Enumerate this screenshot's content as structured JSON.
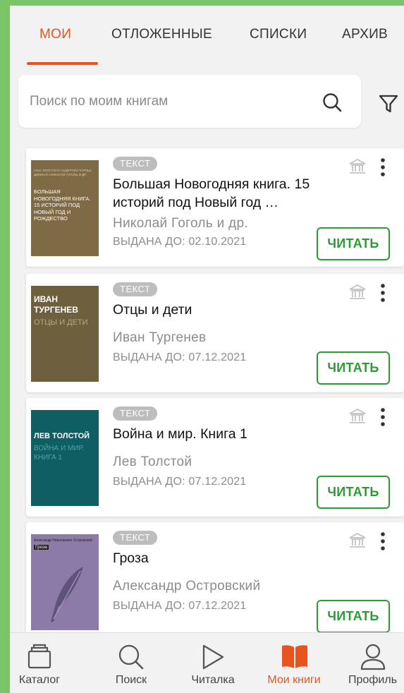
{
  "tabs": [
    {
      "label": "МОИ",
      "active": true
    },
    {
      "label": "ОТЛОЖЕННЫЕ",
      "active": false
    },
    {
      "label": "СПИСКИ",
      "active": false
    },
    {
      "label": "АРХИВ",
      "active": false
    }
  ],
  "search": {
    "placeholder": "Поиск по моим книгам",
    "value": ""
  },
  "colors": {
    "accent": "#e8531f",
    "read_button": "#2e9a35",
    "badge": "#bdbdbd"
  },
  "books": [
    {
      "badge": "ТЕКСТ",
      "title": "Большая Новогодняя книга. 15 историй под Новый год …",
      "author": "Николай Гоголь и др.",
      "due": "ВЫДАНА ДО: 02.10.2021",
      "read_label": "ЧИТАТЬ",
      "cover": {
        "color": "#7e6a45",
        "authors_text": "ГАНС КРИСТИАН АНДЕРСЕН ЧАРЛЬЗ ДИККЕНС НИКОЛАЙ ГОГОЛЬ И ДР.",
        "title_text": "БОЛЬШАЯ НОВОГОДНЯЯ КНИГА. 15 ИСТОРИЙ ПОД НОВЫЙ ГОД И РОЖДЕСТВО"
      }
    },
    {
      "badge": "ТЕКСТ",
      "title": "Отцы и дети",
      "author": "Иван Тургенев",
      "due": "ВЫДАНА ДО: 07.12.2021",
      "read_label": "ЧИТАТЬ",
      "cover": {
        "color": "#6e5f3e",
        "author_text": "ИВАН ТУРГЕНЕВ",
        "title_text": "ОТЦЫ И ДЕТИ"
      }
    },
    {
      "badge": "ТЕКСТ",
      "title": "Война и мир. Книга 1",
      "author": "Лев Толстой",
      "due": "ВЫДАНА ДО: 07.12.2021",
      "read_label": "ЧИТАТЬ",
      "cover": {
        "color": "#0f5e63",
        "author_text": "ЛЕВ ТОЛСТОЙ",
        "title_text": "ВОЙНА И МИР. КНИГА 1"
      }
    },
    {
      "badge": "ТЕКСТ",
      "title": "Гроза",
      "author": "Александр Островский",
      "due": "ВЫДАНА ДО: 07.12.2021",
      "read_label": "ЧИТАТЬ",
      "cover": {
        "color": "#8c7ba8",
        "author_text": "Александр Николаевич Островский",
        "title_text": "Гроза"
      }
    }
  ],
  "bottom_nav": [
    {
      "label": "Каталог",
      "icon": "catalog-icon",
      "active": false
    },
    {
      "label": "Поиск",
      "icon": "search-icon",
      "active": false
    },
    {
      "label": "Читалка",
      "icon": "reader-play-icon",
      "active": false
    },
    {
      "label": "Мои книги",
      "icon": "my-books-icon",
      "active": true
    },
    {
      "label": "Профиль",
      "icon": "profile-icon",
      "active": false
    }
  ]
}
